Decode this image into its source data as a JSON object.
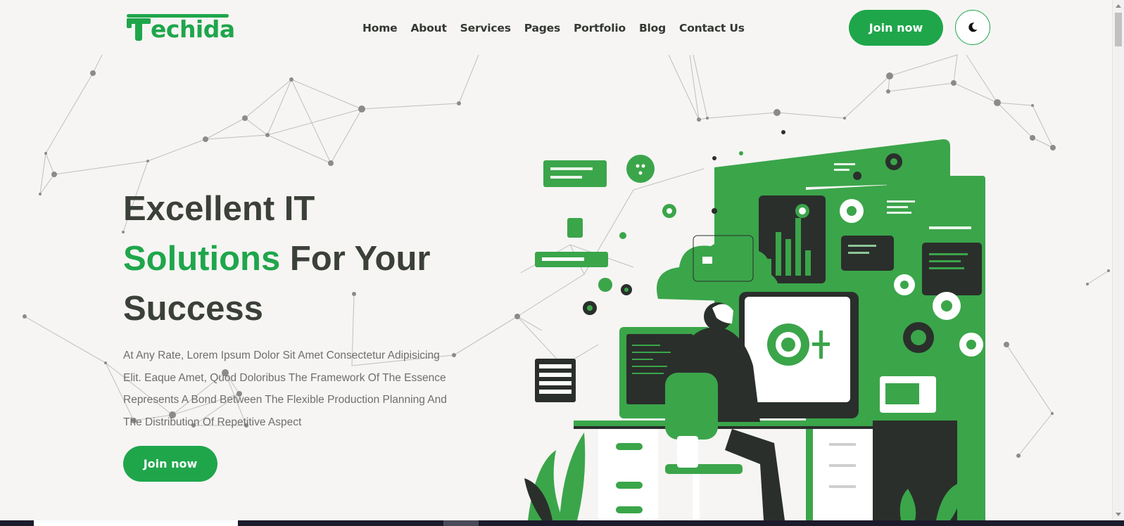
{
  "brand": {
    "name": "Techida",
    "logo_text": "echida",
    "accent_color": "#1fa64b"
  },
  "nav": {
    "items": [
      "Home",
      "About",
      "Services",
      "Pages",
      "Portfolio",
      "Blog",
      "Contact Us"
    ]
  },
  "header": {
    "join_label": "Join now",
    "theme_toggle_icon": "moon-icon"
  },
  "hero": {
    "title_line1": "Excellent IT",
    "title_accent": "Solutions",
    "title_line2_rest": " For Your",
    "title_line3": "Success",
    "description": "At Any Rate, Lorem Ipsum Dolor Sit Amet Consectetur Adipisicing Elit. Eaque Amet, Quod Doloribus The Framework Of The Essence Represents A Bond Between The Flexible Production Planning And The Distribution Of Repetitive Aspect",
    "cta_label": "Join now"
  },
  "illustration": {
    "subject": "it-professional-at-workstation-illustration",
    "colors": {
      "green": "#3ba54a",
      "dark": "#2a2f2b",
      "white": "#ffffff"
    }
  }
}
